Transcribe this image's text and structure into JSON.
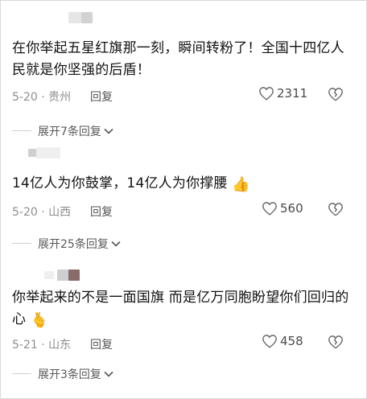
{
  "comments": [
    {
      "text": "在你举起五星红旗那一刻，瞬间转粉了！全国十四亿人民就是你坚强的后盾！",
      "emoji": "",
      "date": "5-20 · 贵州",
      "reply_label": "回复",
      "likes": "2311",
      "expand_label": "展开7条回复"
    },
    {
      "text": "14亿人为你鼓掌，14亿人为你撑腰",
      "emoji": "👍",
      "date": "5-20 · 山西",
      "reply_label": "回复",
      "likes": "560",
      "expand_label": "展开25条回复"
    },
    {
      "text": "你举起来的不是一面国旗 而是亿万同胞盼望你们回归的心",
      "emoji": "🫰",
      "date": "5-21 · 山东",
      "reply_label": "回复",
      "likes": "458",
      "expand_label": "展开3条回复"
    }
  ],
  "icons": {
    "like": "heart-outline-icon",
    "dislike": "broken-heart-outline-icon",
    "expand": "chevron-down-icon"
  },
  "colors": {
    "meta_text": "#8e8e8e",
    "content_text": "#121212"
  }
}
